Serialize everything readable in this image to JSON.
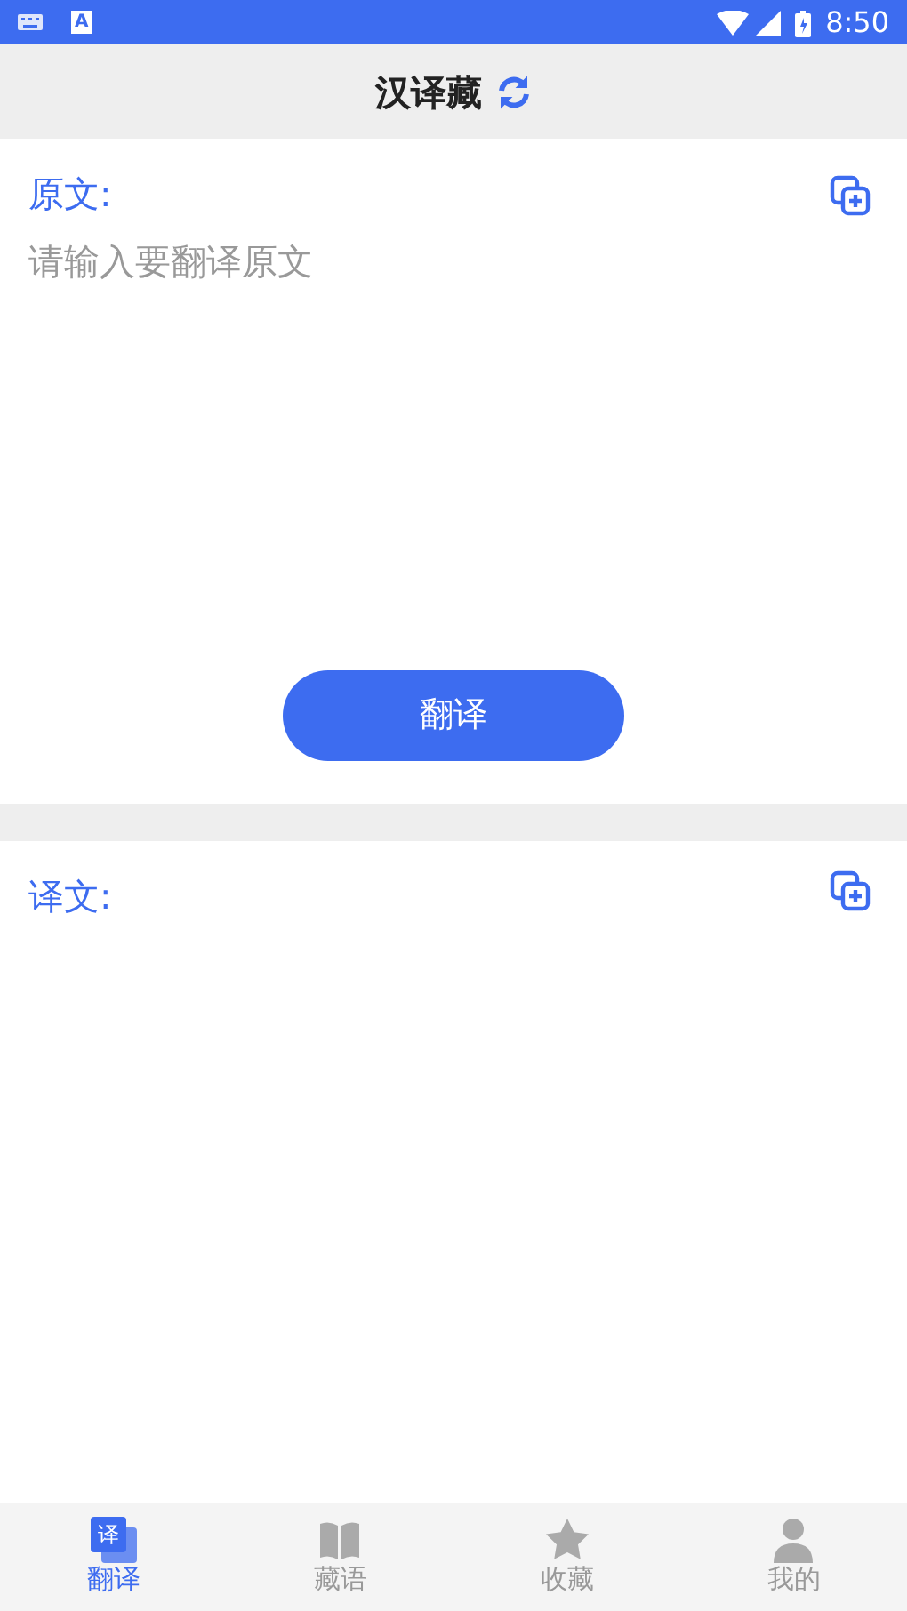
{
  "status_bar": {
    "time": "8:50",
    "notification_letter": "A"
  },
  "header": {
    "title": "汉译藏"
  },
  "source": {
    "label": "原文:",
    "placeholder": "请输入要翻译原文"
  },
  "translate_button": "翻译",
  "target": {
    "label": "译文:"
  },
  "tabs": [
    {
      "label": "翻译",
      "kind": "translate",
      "icon_char": "译",
      "selected": true
    },
    {
      "label": "藏语",
      "kind": "book",
      "selected": false
    },
    {
      "label": "收藏",
      "kind": "star",
      "selected": false
    },
    {
      "label": "我的",
      "kind": "person",
      "selected": false
    }
  ]
}
